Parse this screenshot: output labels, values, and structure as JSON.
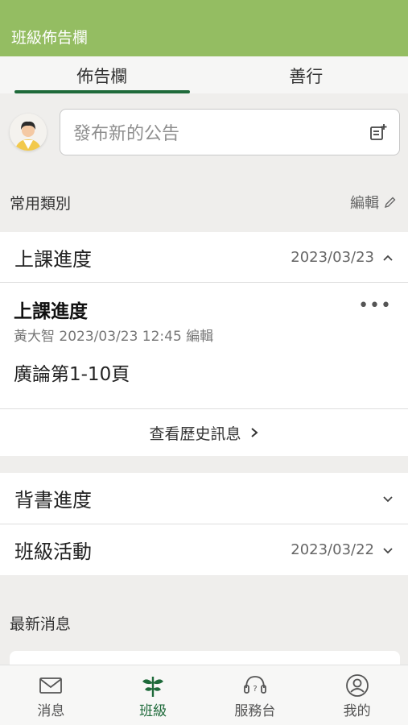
{
  "header": {
    "title": "班級佈告欄"
  },
  "tabs": [
    {
      "label": "佈告欄",
      "active": true
    },
    {
      "label": "善行",
      "active": false
    }
  ],
  "composer": {
    "placeholder": "發布新的公告"
  },
  "common_categories": {
    "title": "常用類別",
    "edit_label": "編輯",
    "rows": [
      {
        "label": "上課進度",
        "date": "2023/03/23",
        "expanded": true
      },
      {
        "label": "背書進度",
        "date": "",
        "expanded": false
      },
      {
        "label": "班級活動",
        "date": "2023/03/22",
        "expanded": false
      }
    ],
    "expanded_post": {
      "title": "上課進度",
      "meta": "黃大智 2023/03/23 12:45 編輯",
      "body": "廣論第1-10頁",
      "more": "•••"
    },
    "history_label": "查看歷史訊息"
  },
  "latest": {
    "title": "最新消息"
  },
  "bottom_nav": [
    {
      "label": "消息",
      "icon": "envelope-icon",
      "active": false
    },
    {
      "label": "班級",
      "icon": "sprout-icon",
      "active": true
    },
    {
      "label": "服務台",
      "icon": "headset-icon",
      "active": false
    },
    {
      "label": "我的",
      "icon": "profile-icon",
      "active": false
    }
  ],
  "colors": {
    "header": "#94bd62",
    "accent": "#1e6a3a"
  }
}
